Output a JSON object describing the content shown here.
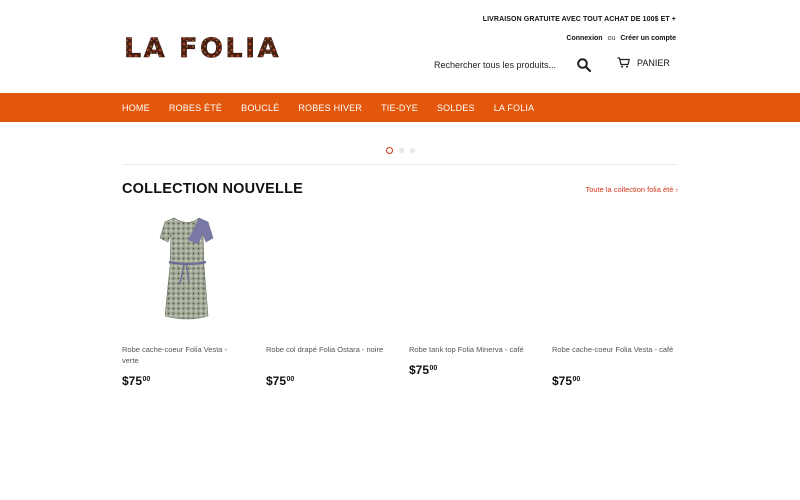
{
  "store": {
    "logo_text": "La Folia",
    "announcement": "LIVRAISON GRATUITE AVEC TOUT ACHAT DE 100$ ET +",
    "login": "Connexion",
    "or": "ou",
    "register": "Créer un compte",
    "search_placeholder": "Rechercher tous les produits...",
    "cart_label": "PANIER",
    "brand_color": "#e3570c"
  },
  "nav": {
    "items": [
      "HOME",
      "ROBES ÉTÉ",
      "BOUCLÉ",
      "ROBES HIVER",
      "TIE-DYE",
      "SOLDES",
      "LA FOLIA"
    ]
  },
  "slider": {
    "dots": 3,
    "active": 1
  },
  "collection": {
    "title": "COLLECTION NOUVELLE",
    "link": "Toute la collection folia été ›",
    "products": [
      {
        "name": "Robe cache-coeur Folia Vesta - verte",
        "price": "$75",
        "cents": "00"
      },
      {
        "name": "Robe col drapé Folia Ostara - noire",
        "price": "$75",
        "cents": "00"
      },
      {
        "name": "Robe tank top Folia Minerva - café",
        "price": "$75",
        "cents": "00"
      },
      {
        "name": "Robe cache-coeur Folia Vesta - café",
        "price": "$75",
        "cents": "00"
      }
    ]
  }
}
